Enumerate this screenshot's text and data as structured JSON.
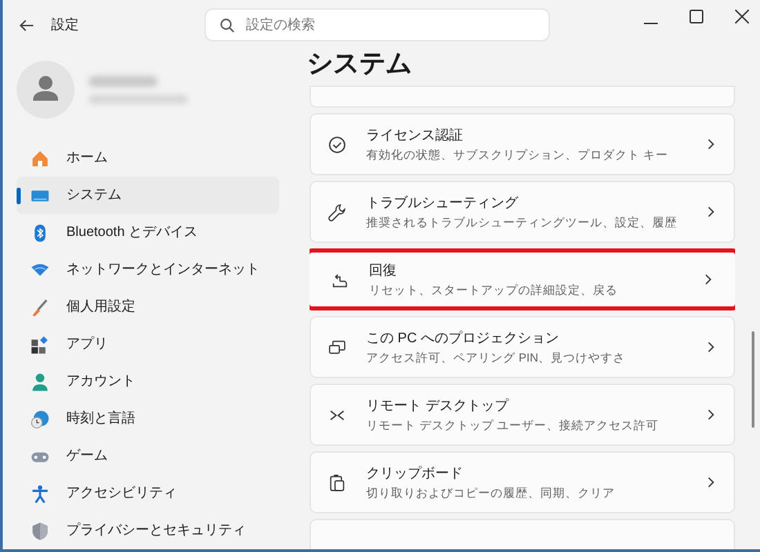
{
  "window": {
    "title": "設定"
  },
  "search": {
    "placeholder": "設定の検索"
  },
  "sidebar": {
    "items": [
      {
        "label": "ホーム",
        "selected": false
      },
      {
        "label": "システム",
        "selected": true
      },
      {
        "label": "Bluetooth とデバイス",
        "selected": false
      },
      {
        "label": "ネットワークとインターネット",
        "selected": false
      },
      {
        "label": "個人用設定",
        "selected": false
      },
      {
        "label": "アプリ",
        "selected": false
      },
      {
        "label": "アカウント",
        "selected": false
      },
      {
        "label": "時刻と言語",
        "selected": false
      },
      {
        "label": "ゲーム",
        "selected": false
      },
      {
        "label": "アクセシビリティ",
        "selected": false
      },
      {
        "label": "プライバシーとセキュリティ",
        "selected": false
      }
    ]
  },
  "page": {
    "title": "システム",
    "items": [
      {
        "title": "ライセンス認証",
        "description": "有効化の状態、サブスクリプション、プロダクト キー",
        "highlighted": false
      },
      {
        "title": "トラブルシューティング",
        "description": "推奨されるトラブルシューティングツール、設定、履歴",
        "highlighted": false
      },
      {
        "title": "回復",
        "description": "リセット、スタートアップの詳細設定、戻る",
        "highlighted": true
      },
      {
        "title": "この PC へのプロジェクション",
        "description": "アクセス許可、ペアリング PIN、見つけやすさ",
        "highlighted": false
      },
      {
        "title": "リモート デスクトップ",
        "description": "リモート デスクトップ ユーザー、接続アクセス許可",
        "highlighted": false
      },
      {
        "title": "クリップボード",
        "description": "切り取りおよびコピーの履歴、同期、クリア",
        "highlighted": false
      }
    ]
  }
}
